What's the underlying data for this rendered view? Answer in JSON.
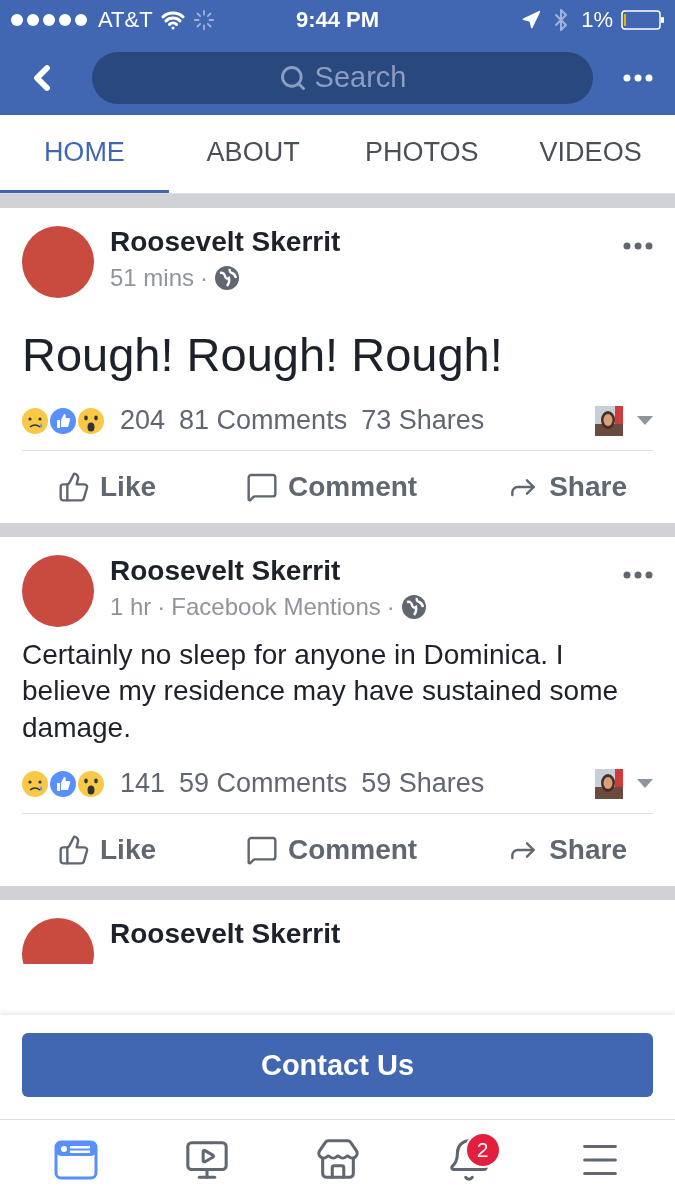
{
  "status_bar": {
    "carrier": "AT&T",
    "time": "9:44 PM",
    "battery": "1%"
  },
  "nav_bar": {
    "search": {
      "placeholder": "Search"
    }
  },
  "tabs": [
    {
      "label": "HOME",
      "selected": true
    },
    {
      "label": "ABOUT",
      "selected": false
    },
    {
      "label": "PHOTOS",
      "selected": false
    },
    {
      "label": "VIDEOS",
      "selected": false
    }
  ],
  "posts": [
    {
      "kind": "large_text",
      "author": "Roosevelt Skerrit",
      "time": "51 mins",
      "separator": "·",
      "text": "Rough! Rough! Rough!",
      "reaction_count": "204",
      "comments": "81 Comments",
      "shares": "73 Shares",
      "actions": [
        "Like",
        "Comment",
        "Share"
      ]
    },
    {
      "kind": "text",
      "author": "Roosevelt Skerrit",
      "time": "1 hr",
      "separator": "·",
      "via": "Facebook Mentions",
      "text": "Certainly no sleep for anyone in Dominica. I believe my residence may have sustained some damage.",
      "reaction_count": "141",
      "comments": "59 Comments",
      "shares": "59 Shares",
      "actions": [
        "Like",
        "Comment",
        "Share"
      ]
    }
  ],
  "next_post": {
    "author": "Roosevelt Skerrit"
  },
  "contact_button": "Contact Us",
  "bottom_nav": [
    {
      "kind": "feed",
      "selected": true
    },
    {
      "kind": "video",
      "selected": false
    },
    {
      "kind": "marketplace",
      "selected": false
    },
    {
      "kind": "notifications",
      "selected": false,
      "badge": "2"
    },
    {
      "kind": "menu",
      "selected": false
    }
  ]
}
